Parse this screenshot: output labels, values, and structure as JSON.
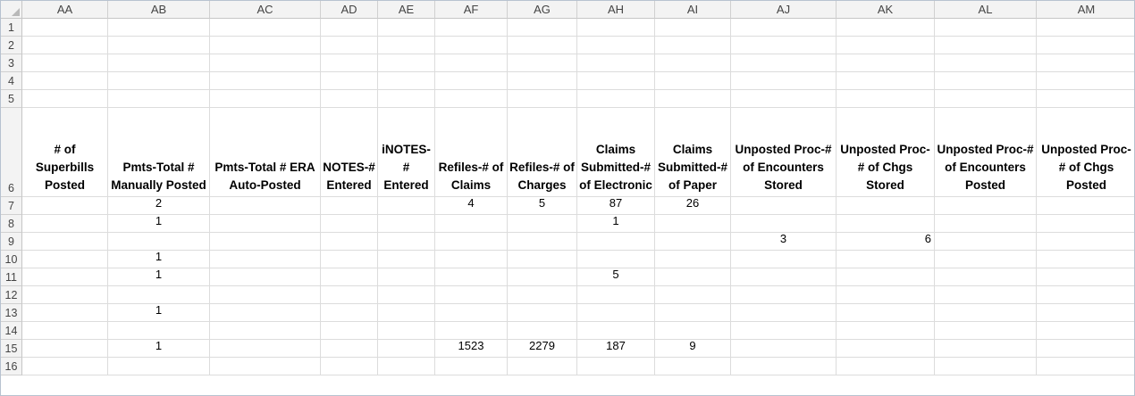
{
  "columns": [
    "AA",
    "AB",
    "AC",
    "AD",
    "AE",
    "AF",
    "AG",
    "AH",
    "AI",
    "AJ",
    "AK",
    "AL",
    "AM"
  ],
  "row_numbers": [
    "1",
    "2",
    "3",
    "4",
    "5",
    "6",
    "7",
    "8",
    "9",
    "10",
    "11",
    "12",
    "13",
    "14",
    "15",
    "16"
  ],
  "header_row": [
    "# of Superbills Posted",
    "Pmts-Total # Manually Posted",
    "Pmts-Total # ERA Auto-Posted",
    "NOTES-# Entered",
    "iNOTES-# Entered",
    "Refiles-# of Claims",
    "Refiles-# of Charges",
    "Claims Submitted-# of Electronic",
    "Claims Submitted-# of Paper",
    "Unposted Proc-# of Encounters Stored",
    "Unposted Proc-# of Chgs Stored",
    "Unposted Proc-# of Encounters Posted",
    "Unposted Proc-# of Chgs Posted"
  ],
  "data_rows": [
    [
      "",
      "2",
      "",
      "",
      "",
      "4",
      "5",
      "87",
      "26",
      "",
      "",
      "",
      ""
    ],
    [
      "",
      "1",
      "",
      "",
      "",
      "",
      "",
      "1",
      "",
      "",
      "",
      "",
      ""
    ],
    [
      "",
      "",
      "",
      "",
      "",
      "",
      "",
      "",
      "",
      "3",
      "6",
      "",
      ""
    ],
    [
      "",
      "1",
      "",
      "",
      "",
      "",
      "",
      "",
      "",
      "",
      "",
      "",
      ""
    ],
    [
      "",
      "1",
      "",
      "",
      "",
      "",
      "",
      "5",
      "",
      "",
      "",
      "",
      ""
    ],
    [
      "",
      "",
      "",
      "",
      "",
      "",
      "",
      "",
      "",
      "",
      "",
      "",
      ""
    ],
    [
      "",
      "1",
      "",
      "",
      "",
      "",
      "",
      "",
      "",
      "",
      "",
      "",
      ""
    ],
    [
      "",
      "",
      "",
      "",
      "",
      "",
      "",
      "",
      "",
      "",
      "",
      "",
      ""
    ],
    [
      "",
      "1",
      "",
      "",
      "",
      "1523",
      "2279",
      "187",
      "9",
      "",
      "",
      "",
      ""
    ],
    [
      "",
      "",
      "",
      "",
      "",
      "",
      "",
      "",
      "",
      "",
      "",
      "",
      ""
    ]
  ]
}
